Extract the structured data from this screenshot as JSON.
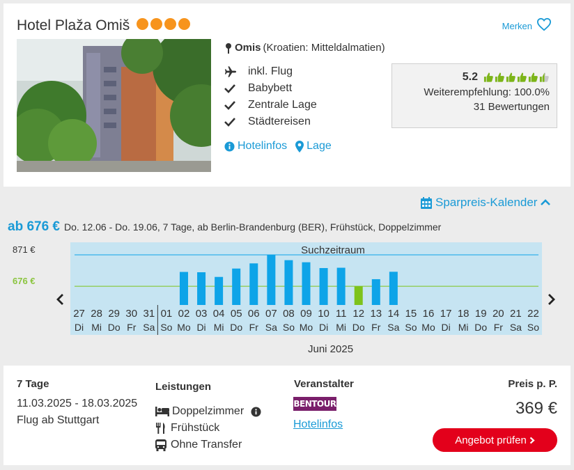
{
  "hotel": {
    "name": "Hotel Plaža Omiš",
    "stars": 4,
    "merken_label": "Merken",
    "location_city": "Omis",
    "location_region": "(Kroatien: Mitteldalmatien)",
    "features": [
      {
        "icon": "plane-icon",
        "label": "inkl. Flug"
      },
      {
        "icon": "check-icon",
        "label": "Babybett"
      },
      {
        "icon": "check-icon",
        "label": "Zentrale Lage"
      },
      {
        "icon": "check-icon",
        "label": "Städtereisen"
      }
    ],
    "link_hotelinfos": "Hotelinfos",
    "link_lage": "Lage",
    "rating": {
      "score": "5.2",
      "thumbs_filled": 5.5,
      "thumbs_total": 6,
      "recommendation": "Weiterempfehlung: 100.0%",
      "reviews": "31 Bewertungen"
    }
  },
  "calendar": {
    "toggle_label": "Sparpreis-Kalender",
    "price_from": "ab 676 €",
    "details": "Do. 12.06 - Do. 19.06, 7 Tage, ab Berlin-Brandenburg (BER), Frühstück, Doppelzimmer",
    "y_max_label": "871 €",
    "y_min_label": "676 €",
    "search_window_label": "Suchzeitraum",
    "month_label": "Juni 2025",
    "colors": {
      "bar": "#0ea4e8",
      "selected": "#7dc31c",
      "bg": "#c6e4f2",
      "max_line": "#0ea4e8",
      "min_line": "#7dc31c"
    }
  },
  "chart_data": {
    "type": "bar",
    "x": [
      "27",
      "28",
      "29",
      "30",
      "31",
      "01",
      "02",
      "03",
      "04",
      "05",
      "06",
      "07",
      "08",
      "09",
      "10",
      "11",
      "12",
      "13",
      "14",
      "15",
      "16",
      "17",
      "18",
      "19",
      "20",
      "21",
      "22"
    ],
    "weekdays": [
      "Di",
      "Mi",
      "Do",
      "Fr",
      "Sa",
      "So",
      "Mo",
      "Di",
      "Mi",
      "Do",
      "Fr",
      "Sa",
      "So",
      "Mo",
      "Di",
      "Mi",
      "Do",
      "Fr",
      "Sa",
      "So",
      "Mo",
      "Di",
      "Mi",
      "Do",
      "Fr",
      "Sa",
      "So"
    ],
    "values": [
      null,
      null,
      null,
      null,
      null,
      null,
      765,
      763,
      734,
      786,
      818,
      871,
      838,
      825,
      789,
      791,
      676,
      720,
      766,
      null,
      null,
      null,
      null,
      null,
      null,
      null,
      null
    ],
    "selected_index": 16,
    "ylim": [
      560,
      871
    ],
    "reference_lines": [
      871,
      676
    ]
  },
  "offer": {
    "duration": "7 Tage",
    "dates": "11.03.2025 - 18.03.2025",
    "flight": "Flug ab Stuttgart",
    "services_title": "Leistungen",
    "services": [
      {
        "icon": "bed-icon",
        "label": "Doppelzimmer"
      },
      {
        "icon": "cutlery-icon",
        "label": "Frühstück"
      },
      {
        "icon": "bus-icon",
        "label": "Ohne Transfer"
      }
    ],
    "operator_title": "Veranstalter",
    "operator_logo_text": "BENTOUR",
    "operator_link": "Hotelinfos",
    "price_title": "Preis p. P.",
    "price": "369 €",
    "cta": "Angebot prüfen"
  }
}
